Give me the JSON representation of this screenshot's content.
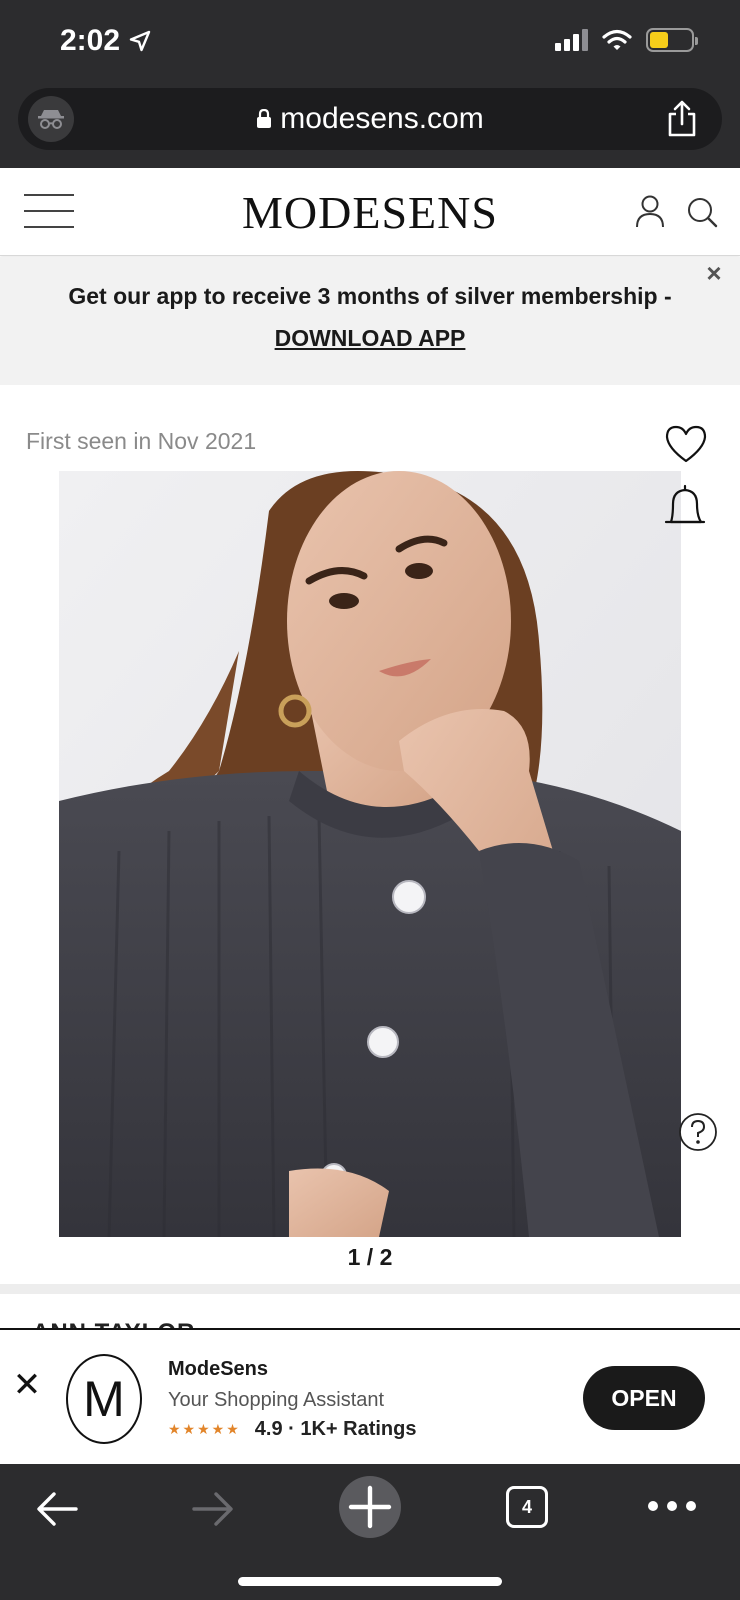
{
  "status_bar": {
    "time": "2:02",
    "battery_level": 0.45,
    "colors": {
      "background": "#2c2c2e",
      "battery": "#f5cd1a"
    }
  },
  "browser": {
    "url": "modesens.com",
    "tab_count": "4"
  },
  "site_header": {
    "logo": "MODESENS"
  },
  "promo_banner": {
    "text": "Get our app to receive 3 months of silver membership -",
    "link": "DOWNLOAD APP",
    "close_icon": "×"
  },
  "product": {
    "first_seen": "First seen in Nov 2021",
    "image_pager": "1 / 2",
    "image_description_icon": "product-photo",
    "brand_peek": "ANN TAYLOR"
  },
  "app_bar": {
    "close_icon": "✕",
    "logo_letter": "M",
    "name": "ModeSens",
    "tagline": "Your Shopping Assistant",
    "stars": "★★★★★",
    "rating": "4.9 · 1K+ Ratings",
    "open_label": "OPEN",
    "colors": {
      "stars": "#e2852a",
      "button": "#1a1a1a"
    }
  },
  "icons": {
    "location": "location-arrow-icon",
    "signal": "cellular-signal-icon",
    "wifi": "wifi-icon",
    "battery": "battery-icon",
    "incognito": "incognito-icon",
    "lock": "lock-icon",
    "share": "share-icon",
    "menu": "hamburger-menu-icon",
    "account": "account-icon",
    "search": "search-icon",
    "heart": "heart-icon",
    "bell": "bell-icon",
    "help": "help-icon",
    "back": "back-arrow-icon",
    "forward": "forward-arrow-icon",
    "new_tab": "plus-icon",
    "more": "more-dots-icon"
  }
}
